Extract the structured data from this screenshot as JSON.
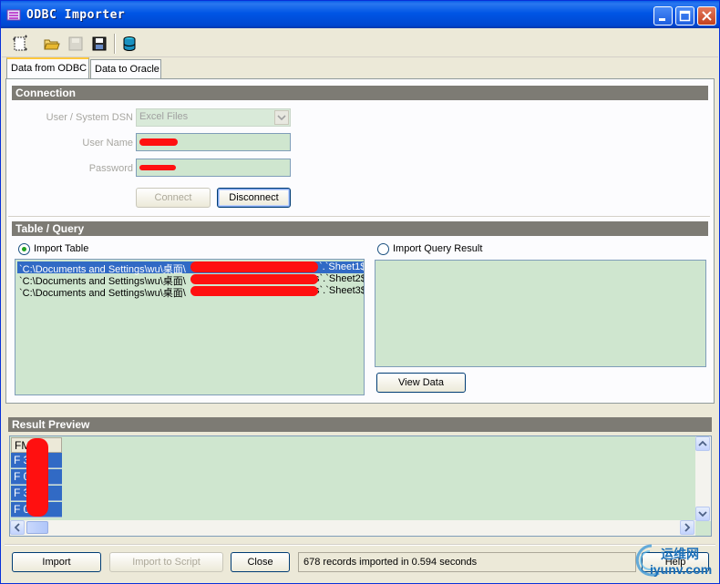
{
  "window": {
    "title": "ODBC Importer",
    "title_color": "#0055e5"
  },
  "toolbar": {
    "items": [
      "new-icon",
      "open-folder-icon",
      "save-disabled-icon",
      "save-icon",
      "database-icon"
    ]
  },
  "tabs": [
    {
      "label": "Data from ODBC",
      "active": true
    },
    {
      "label": "Data to Oracle",
      "active": false
    }
  ],
  "connection": {
    "header": "Connection",
    "dsn_label": "User / System DSN",
    "dsn_value": "Excel Files",
    "username_label": "User Name",
    "password_label": "Password",
    "connect_label": "Connect",
    "disconnect_label": "Disconnect"
  },
  "table_query": {
    "header": "Table / Query",
    "import_table_label": "Import Table",
    "import_query_label": "Import Query Result",
    "tables": [
      {
        "prefix": "`C:\\Documents and Settings\\wu\\桌面\\",
        "suffix": "`.`Sheet1$",
        "selected": true
      },
      {
        "prefix": "`C:\\Documents and Settings\\wu\\桌面\\",
        "suffix": "s`.`Sheet2$",
        "selected": false
      },
      {
        "prefix": "`C:\\Documents and Settings\\wu\\桌面\\",
        "suffix": "s`.`Sheet3$",
        "selected": false
      }
    ],
    "view_data_label": "View Data"
  },
  "result_preview": {
    "header": "Result Preview",
    "column_header": "FM 96",
    "rows": [
      "F 3",
      "F 0",
      "F 3",
      "F 02"
    ]
  },
  "footer": {
    "import_label": "Import",
    "import_script_label": "Import to Script",
    "close_label": "Close",
    "status_text": "678 records imported in 0.594 seconds",
    "help_label": "Help"
  },
  "watermark": {
    "top": "运维网",
    "bottom": "iyunv.com"
  },
  "colors": {
    "accent_selection": "#316ac5",
    "field_bg": "#cfe6cf",
    "group_header": "#7d7b74",
    "redaction": "#ff1010"
  }
}
